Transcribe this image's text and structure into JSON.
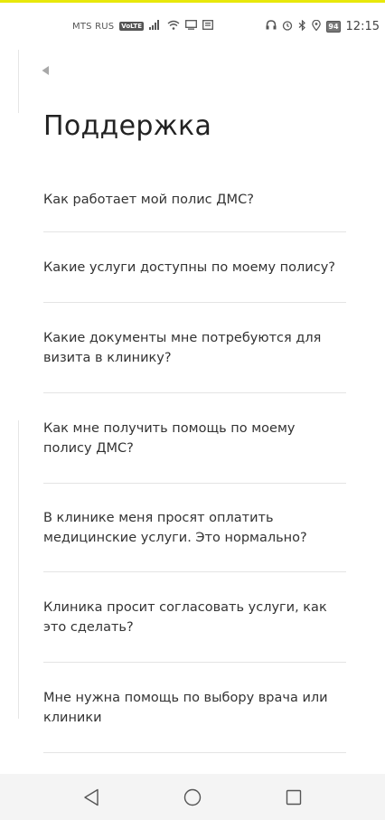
{
  "status_bar": {
    "carrier": "MTS RUS",
    "volte_badge": "VoLTE",
    "battery_level": "94",
    "time": "12:15"
  },
  "header": {
    "back_icon": "back-arrow-icon",
    "title": "Поддержка"
  },
  "faq": {
    "items": [
      {
        "label": "Как работает мой полис ДМС?"
      },
      {
        "label": "Какие услуги доступны по моему полису?"
      },
      {
        "label": "Какие документы мне потребуются для визита в клинику?"
      },
      {
        "label": "Как мне получить помощь по моему полису ДМС?"
      },
      {
        "label": "В клинике меня просят оплатить медицинские услуги. Это нормально?"
      },
      {
        "label": "Клиника просит согласовать услуги, как это сделать?"
      },
      {
        "label": "Мне нужна помощь по выбору врача или клиники"
      }
    ]
  },
  "nav_bar": {
    "back_icon": "triangle-back-icon",
    "home_icon": "circle-home-icon",
    "recents_icon": "square-recents-icon"
  },
  "colors": {
    "accent_top": "#e8e80a",
    "text": "#333333",
    "divider": "#e4e4e4",
    "nav_background": "#f4f4f4"
  }
}
